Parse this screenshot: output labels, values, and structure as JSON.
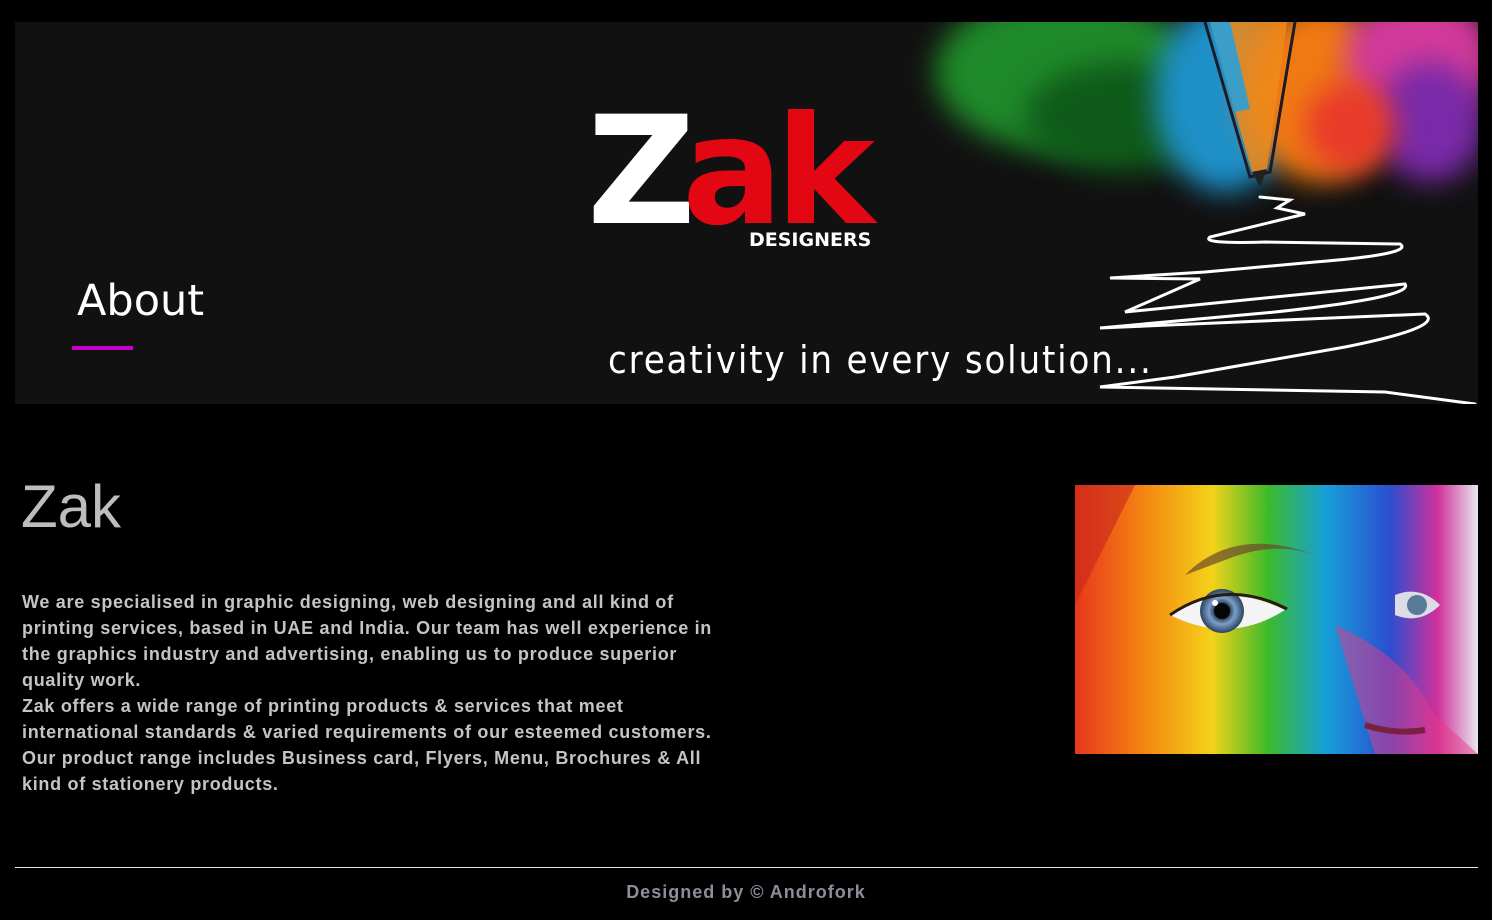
{
  "banner": {
    "logo": {
      "z": "Z",
      "ak": "ak",
      "sub": "DESIGNERS"
    },
    "title": "About",
    "tagline": "creativity in every solution..."
  },
  "main": {
    "heading": "Zak",
    "paragraphs": [
      "We are specialised in graphic designing, web designing and all kind of printing services, based in UAE and India. Our team has well experience in the graphics industry and advertising, enabling us to produce superior quality work.",
      "Zak offers a wide range of printing products & services that meet international standards & varied requirements of our esteemed customers. Our product range includes Business card, Flyers, Menu, Brochures & All kind of stationery products."
    ]
  },
  "footer": {
    "text": "Designed by © Androfork"
  },
  "colors": {
    "background": "#000000",
    "banner": "#111111",
    "brand_red": "#e30613",
    "accent_magenta": "#c800c8",
    "body_text": "#c4c4c4",
    "footer_text": "#8a8f9a"
  }
}
